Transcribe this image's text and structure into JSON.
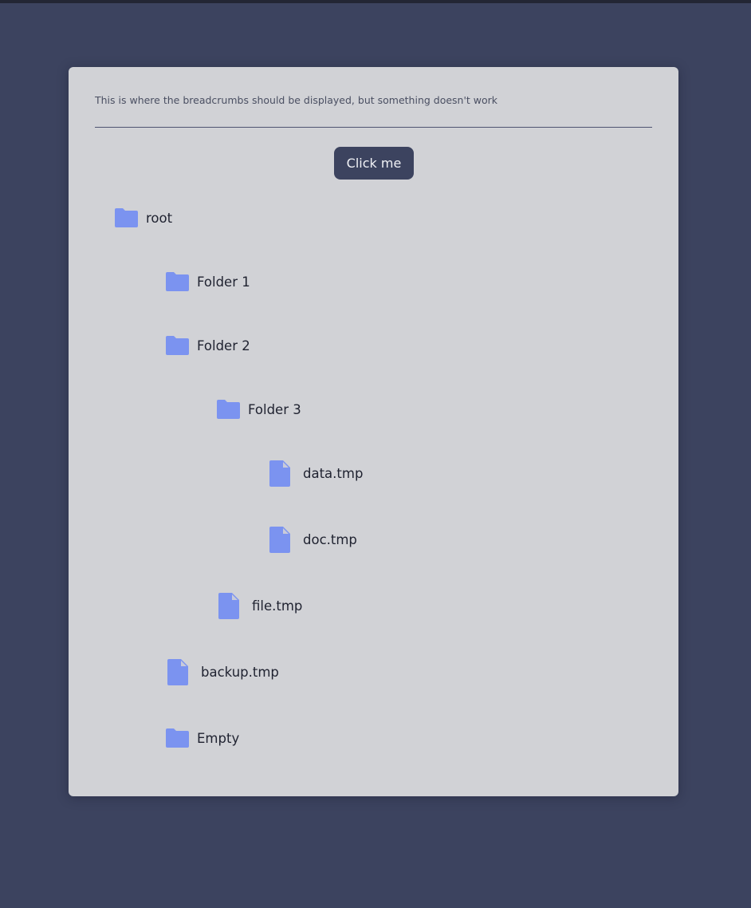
{
  "card": {
    "breadcrumbs_text": "This is where the breadcrumbs should be displayed, but something doesn't work",
    "button_label": "Click me"
  },
  "tree": {
    "root": "root",
    "folder_1": "Folder 1",
    "folder_2": "Folder 2",
    "folder_3": "Folder 3",
    "data_file": "data.tmp",
    "doc_file": "doc.tmp",
    "file_file": "file.tmp",
    "backup_file": "backup.tmp",
    "empty_folder": "Empty"
  },
  "colors": {
    "page_background": "#3c435f",
    "card_background": "#d1d2d6",
    "button_background": "#3c435f",
    "icon_color": "#7b93f0"
  },
  "icons": {
    "folder": "folder-icon",
    "file": "file-icon"
  }
}
